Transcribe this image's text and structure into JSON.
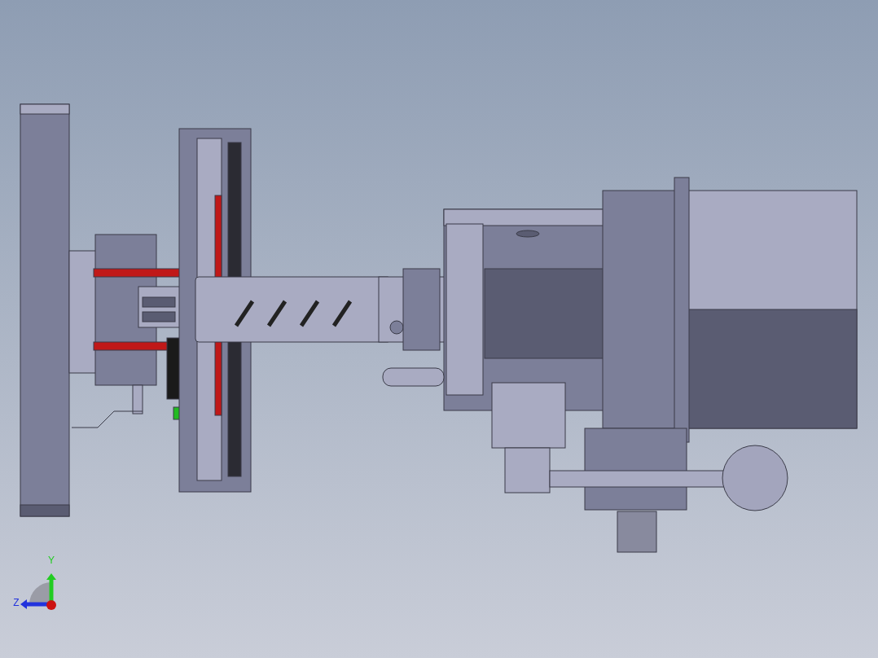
{
  "viewport": {
    "triad": {
      "axes": [
        {
          "label": "Y",
          "color": "#22cc22"
        },
        {
          "label": "Z",
          "color": "#2233dd"
        }
      ]
    }
  }
}
